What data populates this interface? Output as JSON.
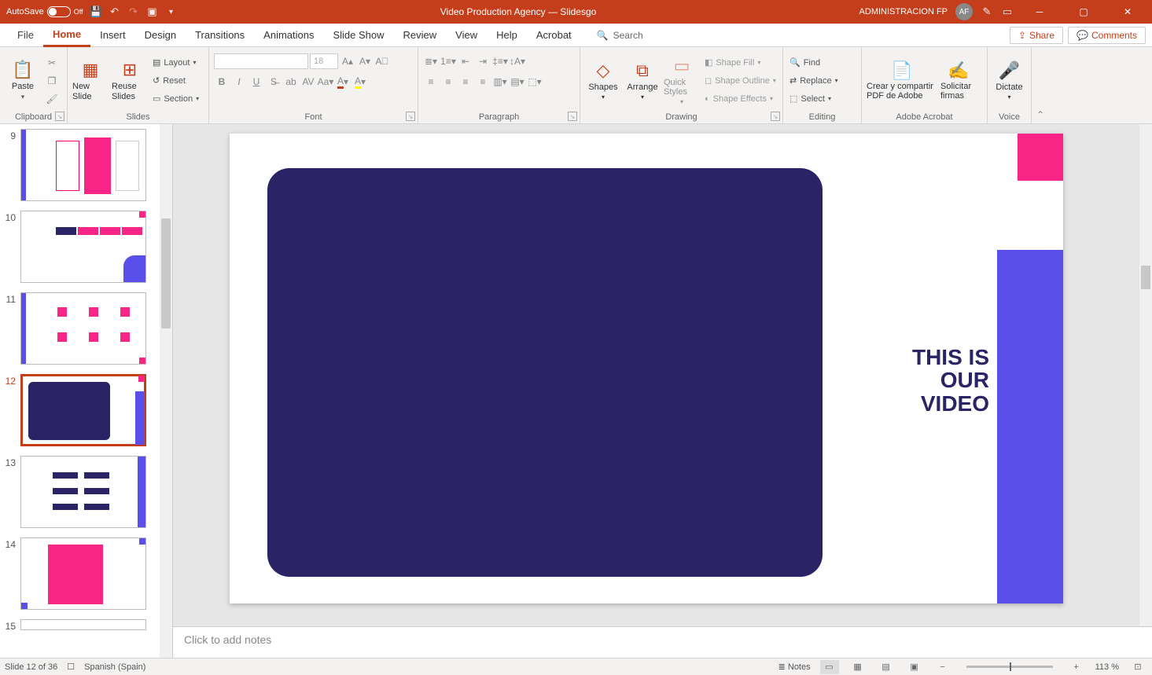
{
  "titlebar": {
    "autosave_label": "AutoSave",
    "autosave_state": "Off",
    "title": "Video Production Agency — Slidesgo",
    "user_label": "ADMINISTRACION FP",
    "avatar": "AF"
  },
  "tabs": {
    "file": "File",
    "home": "Home",
    "insert": "Insert",
    "design": "Design",
    "transitions": "Transitions",
    "animations": "Animations",
    "slideshow": "Slide Show",
    "review": "Review",
    "view": "View",
    "help": "Help",
    "acrobat": "Acrobat",
    "search_placeholder": "Search",
    "share": "Share",
    "comments": "Comments"
  },
  "ribbon": {
    "clipboard": {
      "label": "Clipboard",
      "paste": "Paste"
    },
    "slides": {
      "label": "Slides",
      "new_slide": "New Slide",
      "reuse": "Reuse Slides",
      "layout": "Layout",
      "reset": "Reset",
      "section": "Section"
    },
    "font": {
      "label": "Font",
      "size": "18"
    },
    "paragraph": {
      "label": "Paragraph"
    },
    "drawing": {
      "label": "Drawing",
      "shapes": "Shapes",
      "arrange": "Arrange",
      "quick": "Quick Styles",
      "fill": "Shape Fill",
      "outline": "Shape Outline",
      "effects": "Shape Effects"
    },
    "editing": {
      "label": "Editing",
      "find": "Find",
      "replace": "Replace",
      "select": "Select"
    },
    "acrobat": {
      "label": "Adobe Acrobat",
      "create": "Crear y compartir PDF de Adobe",
      "sign": "Solicitar firmas"
    },
    "voice": {
      "label": "Voice",
      "dictate": "Dictate"
    }
  },
  "thumbs": {
    "numbers": [
      "9",
      "10",
      "11",
      "12",
      "13",
      "14",
      "15"
    ],
    "active_index": 3
  },
  "slide": {
    "title_line1": "THIS IS",
    "title_line2": "OUR VIDEO"
  },
  "notes": {
    "placeholder": "Click to add notes"
  },
  "status": {
    "slide_counter": "Slide 12 of 36",
    "language": "Spanish (Spain)",
    "notes": "Notes",
    "zoom": "113 %"
  }
}
